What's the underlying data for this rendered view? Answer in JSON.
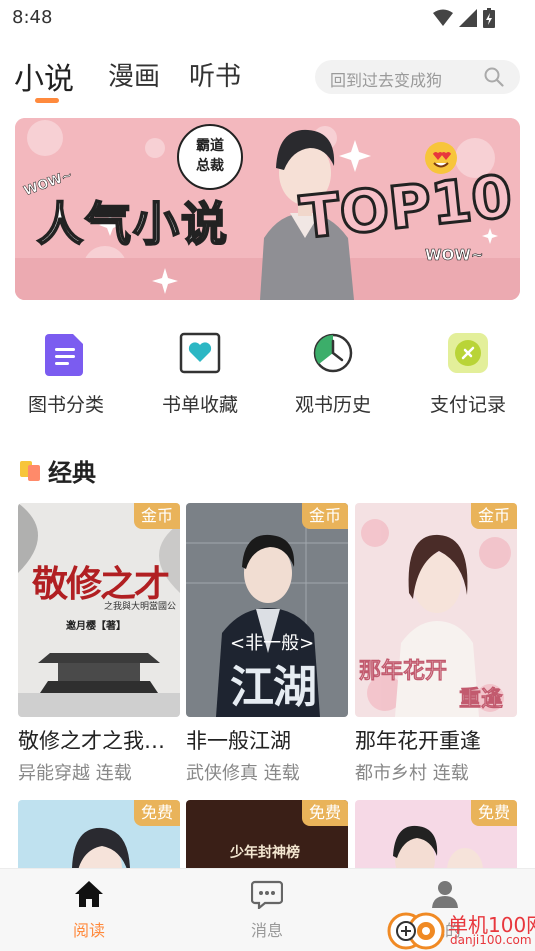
{
  "status_bar": {
    "time": "8:48"
  },
  "top_nav": {
    "tabs": [
      {
        "label": "小说",
        "active": true
      },
      {
        "label": "漫画",
        "active": false
      },
      {
        "label": "听书",
        "active": false
      }
    ]
  },
  "search": {
    "placeholder": "回到过去变成狗"
  },
  "banner": {
    "main_text": "人气小说",
    "top_text": "TOP10",
    "wow_left": "WOW~",
    "wow_right": "WOW~",
    "badge_line1": "霸道",
    "badge_line2": "总裁"
  },
  "quick_links": [
    {
      "label": "图书分类",
      "icon": "book-category-icon",
      "color": "#7b5cf0"
    },
    {
      "label": "书单收藏",
      "icon": "heart-box-icon",
      "color": "#2cb7c4"
    },
    {
      "label": "观书历史",
      "icon": "clock-icon",
      "color": "#3cae6a"
    },
    {
      "label": "支付记录",
      "icon": "payment-tag-icon",
      "color": "#b9d437"
    }
  ],
  "section": {
    "title": "经典"
  },
  "books": [
    {
      "title": "敬修之才之我…",
      "meta": "异能穿越 连载",
      "tag": "金币",
      "cover_title": "敬修之才",
      "cover_sub": "之我與大明當國公",
      "cover_author": "邀月樱【著】"
    },
    {
      "title": "非一般江湖",
      "meta": "武侠修真 连载",
      "tag": "金币",
      "cover_title": "江湖",
      "cover_sub": "<非一般>"
    },
    {
      "title": "那年花开重逢",
      "meta": "都市乡村 连载",
      "tag": "金币",
      "cover_title": "那年花开",
      "cover_sub": "重逢"
    }
  ],
  "books_row2": [
    {
      "tag": "免费"
    },
    {
      "tag": "免费",
      "cover_title": "少年封神榜"
    },
    {
      "tag": "免费"
    }
  ],
  "bottom_bar": {
    "items": [
      {
        "label": "阅读",
        "icon": "home-icon",
        "active": true
      },
      {
        "label": "消息",
        "icon": "message-icon",
        "active": false
      },
      {
        "label": "我的",
        "icon": "user-icon",
        "active": false
      }
    ]
  },
  "watermark": {
    "text": "单机100网",
    "sub": "danji100.com"
  },
  "colors": {
    "accent": "#ff8a3d",
    "tag": "#e9b35a"
  }
}
